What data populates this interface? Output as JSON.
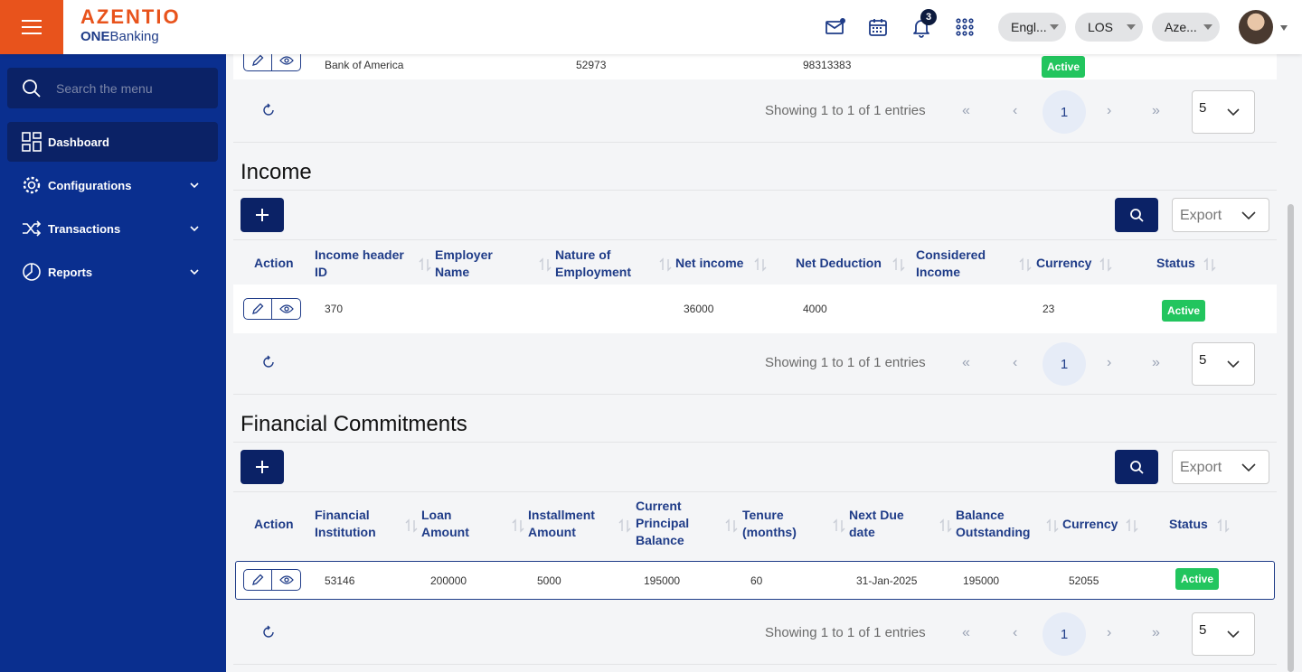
{
  "brand": {
    "name": "AZENTIO",
    "sub_bold": "ONE",
    "sub_rest": "Banking"
  },
  "topbar": {
    "notification_count": "3",
    "language": "Engl...",
    "module": "LOS",
    "entity": "Aze..."
  },
  "sidebar": {
    "search_placeholder": "Search the menu",
    "items": [
      {
        "label": "Dashboard"
      },
      {
        "label": "Configurations"
      },
      {
        "label": "Transactions"
      },
      {
        "label": "Reports"
      }
    ]
  },
  "prev_table": {
    "row": {
      "bank": "Bank of America",
      "col2": "52973",
      "col3": "98313383",
      "status": "Active"
    },
    "pager": {
      "info": "Showing 1 to 1 of 1 entries",
      "page": "1",
      "page_size": "5"
    }
  },
  "income": {
    "title": "Income",
    "export_label": "Export",
    "headers": [
      "Action",
      "Income header ID",
      "Employer Name",
      "Nature of Employment",
      "Net income",
      "Net Deduction",
      "Considered Income",
      "Currency",
      "Status"
    ],
    "row": {
      "id": "370",
      "employer": "",
      "nature": "",
      "net_income": "36000",
      "net_deduction": "4000",
      "considered": "",
      "currency": "23",
      "status": "Active"
    },
    "pager": {
      "info": "Showing 1 to 1 of 1 entries",
      "page": "1",
      "page_size": "5"
    }
  },
  "commitments": {
    "title": "Financial Commitments",
    "export_label": "Export",
    "headers": [
      "Action",
      "Financial Institution",
      "Loan Amount",
      "Installment Amount",
      "Current Principal Balance",
      "Tenure (months)",
      "Next Due date",
      "Balance Outstanding",
      "Currency",
      "Status"
    ],
    "row": {
      "institution": "53146",
      "loan": "200000",
      "installment": "5000",
      "principal": "195000",
      "tenure": "60",
      "due": "31-Jan-2025",
      "balance": "195000",
      "currency": "52055",
      "status": "Active"
    },
    "pager": {
      "info": "Showing 1 to 1 of 1 entries",
      "page": "1",
      "page_size": "5"
    }
  },
  "colors": {
    "brand_orange": "#e8531c",
    "sidebar_blue": "#0a2f8f",
    "navy": "#0b2266",
    "active_green": "#22c55e"
  }
}
